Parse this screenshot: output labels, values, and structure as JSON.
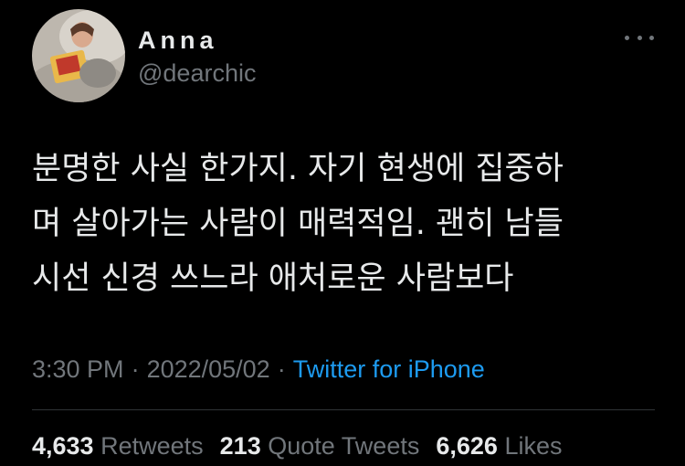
{
  "user": {
    "display_name": "Anna",
    "handle": "@dearchic"
  },
  "tweet": {
    "lines": [
      "분명한 사실 한가지. 자기 현생에 집중하",
      "며 살아가는 사람이 매력적임. 괜히 남들",
      "시선 신경 쓰느라 애처로운 사람보다"
    ],
    "time": "3:30 PM",
    "date": "2022/05/02",
    "separator": "·",
    "source": "Twitter for iPhone"
  },
  "stats": {
    "retweets_count": "4,633",
    "retweets_label": "Retweets",
    "quote_tweets_count": "213",
    "quote_tweets_label": "Quote Tweets",
    "likes_count": "6,626",
    "likes_label": "Likes"
  },
  "icons": {
    "more": "more-horizontal-icon"
  },
  "colors": {
    "background": "#000000",
    "primary_text": "#e7e9ea",
    "secondary_text": "#71767b",
    "link": "#1d9bf0",
    "divider": "#2f3336"
  }
}
